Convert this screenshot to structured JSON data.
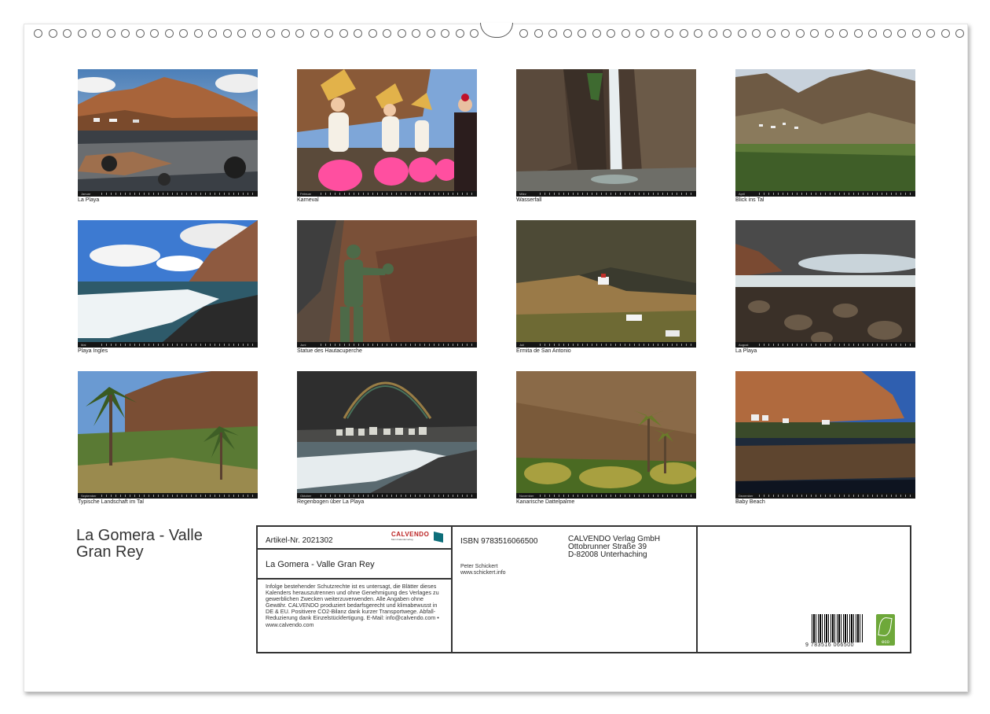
{
  "calendar": {
    "title": "La Gomera - Valle Gran Rey",
    "photos": [
      {
        "caption": "La Playa",
        "month": "Januar"
      },
      {
        "caption": "Karneval",
        "month": "Februar"
      },
      {
        "caption": "Wasserfall",
        "month": "März"
      },
      {
        "caption": "Blick ins Tal",
        "month": "April"
      },
      {
        "caption": "Playa Ingles",
        "month": "Mai"
      },
      {
        "caption": "Statue des Hautacuperche",
        "month": "Juni"
      },
      {
        "caption": "Ermita de San Antonio",
        "month": "Juli"
      },
      {
        "caption": "La Playa",
        "month": "August"
      },
      {
        "caption": "Typische Landschaft im Tal",
        "month": "September"
      },
      {
        "caption": "Regenbogen über La Playa",
        "month": "Oktober"
      },
      {
        "caption": "Kanarische Dattelpalme",
        "month": "November"
      },
      {
        "caption": "Baby Beach",
        "month": "Dezember"
      }
    ]
  },
  "imprint": {
    "article": "Artikel-Nr. 2021302",
    "logo_brand": "CALVENDO",
    "logo_tagline": "Mein Kalenderverlag",
    "title": "La Gomera - Valle Gran Rey",
    "legal": "Infolge bestehender Schutzrechte ist es untersagt, die Blätter dieses Kalenders herauszutrennen und ohne Genehmigung des Verlages zu gewerblichen Zwecken weiterzuverwenden. Alle Angaben ohne Gewähr. CALVENDO produziert bedarfsgerecht und klimabewusst in DE & EU. Positivere CO2-Bilanz dank kurzer Transportwege. Abfall-Reduzierung dank Einzelstückfertigung. E-Mail: info@calvendo.com • www.calvendo.com",
    "isbn": "ISBN 9783516066500",
    "publisher_line1": "CALVENDO Verlag GmbH",
    "publisher_line2": "Ottobrunner Straße 39",
    "publisher_line3": "D-82008 Unterhaching",
    "author_name": "Peter Schickert",
    "author_url": "www.schickert.info",
    "barcode_number": "9 783516 066500",
    "eco_label": "eco"
  },
  "colors": {
    "frame": "#333333",
    "eco_green": "#6ea83a",
    "brand_red": "#b22222",
    "brand_teal": "#0d6e7a"
  }
}
